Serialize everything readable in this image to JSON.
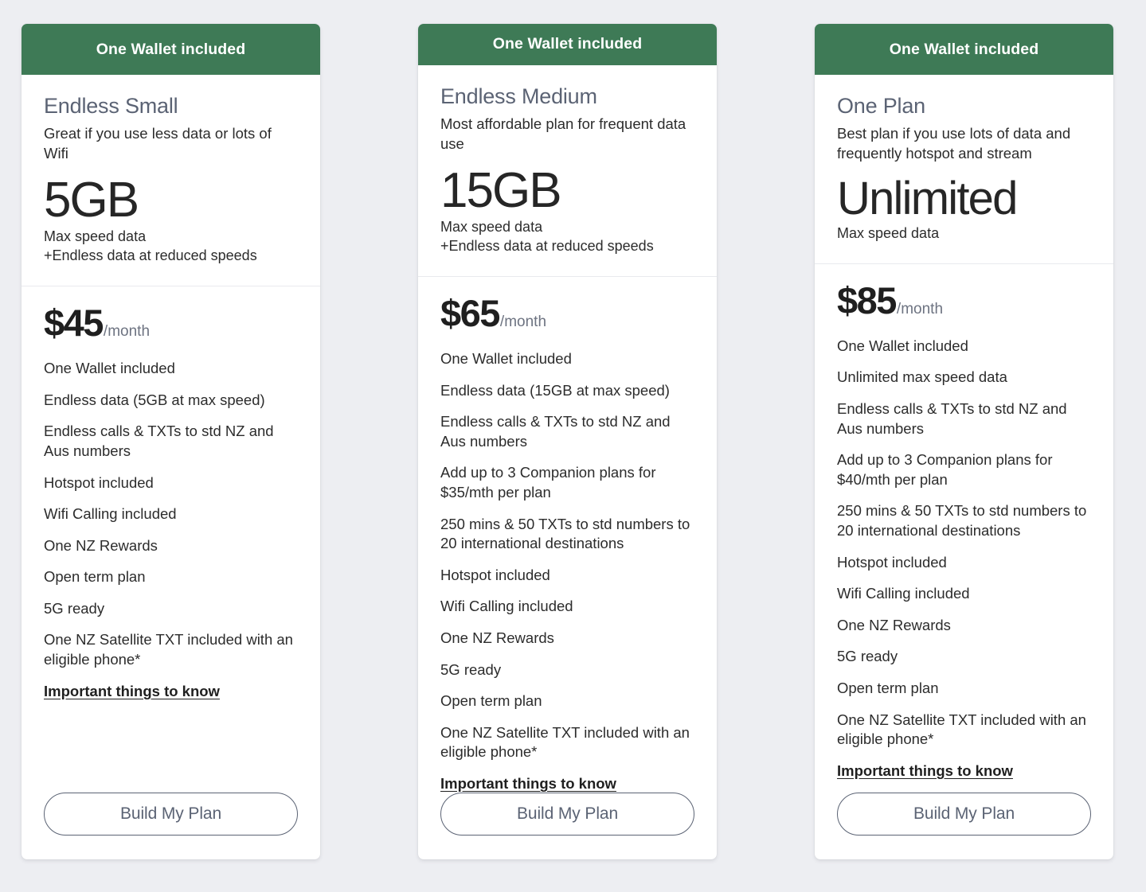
{
  "page": {
    "background_color": "#edeef2",
    "banner_color": "#3e7a56",
    "title_color": "#5b6374"
  },
  "plans": [
    {
      "banner": "One Wallet included",
      "name": "Endless Small",
      "description": "Great if you use less data or lots of Wifi",
      "data_amount": "5GB",
      "data_sub_line1": "Max speed data",
      "data_sub_line2": "+Endless data at reduced speeds",
      "price": "$45",
      "price_period": "/month",
      "features": [
        "One Wallet included",
        "Endless data (5GB at max speed)",
        "Endless calls & TXTs to std NZ and Aus numbers",
        "Hotspot included",
        "Wifi Calling included",
        "One NZ Rewards",
        "Open term plan",
        "5G ready",
        "One NZ Satellite TXT included with an eligible phone*"
      ],
      "info_link": "Important things to know",
      "cta": "Build My Plan"
    },
    {
      "banner": "One Wallet included",
      "name": "Endless Medium",
      "description": "Most affordable plan for frequent data use",
      "data_amount": "15GB",
      "data_sub_line1": "Max speed data",
      "data_sub_line2": "+Endless data at reduced speeds",
      "price": "$65",
      "price_period": "/month",
      "features": [
        "One Wallet included",
        "Endless data (15GB at max speed)",
        "Endless calls & TXTs to std NZ and Aus numbers",
        "Add up to 3 Companion plans for $35/mth per plan",
        "250 mins & 50 TXTs to std numbers to 20 international destinations",
        "Hotspot included",
        "Wifi Calling included",
        "One NZ Rewards",
        "5G ready",
        "Open term plan",
        "One NZ Satellite TXT included with an eligible phone*"
      ],
      "info_link": "Important things to know",
      "cta": "Build My Plan"
    },
    {
      "banner": "One Wallet included",
      "name": "One Plan",
      "description": "Best plan if you use lots of data and frequently hotspot and stream",
      "data_amount": "Unlimited",
      "data_sub_line1": "Max speed data",
      "data_sub_line2": "",
      "price": "$85",
      "price_period": "/month",
      "features": [
        "One Wallet included",
        "Unlimited max speed data",
        "Endless calls & TXTs to std NZ and Aus numbers",
        "Add up to 3 Companion plans for $40/mth per plan",
        "250 mins & 50 TXTs to std numbers to 20 international destinations",
        "Hotspot included",
        "Wifi Calling included",
        "One NZ Rewards",
        "5G ready",
        "Open term plan",
        "One NZ Satellite TXT included with an eligible phone*"
      ],
      "info_link": "Important things to know",
      "cta": "Build My Plan"
    }
  ]
}
